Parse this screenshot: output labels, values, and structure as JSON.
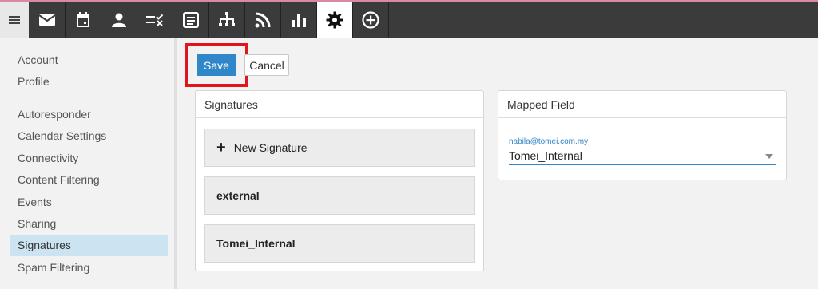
{
  "toolbar": {
    "apps": [
      {
        "name": "mail-icon"
      },
      {
        "name": "calendar-icon"
      },
      {
        "name": "contacts-icon"
      },
      {
        "name": "tasks-icon"
      },
      {
        "name": "notes-icon"
      },
      {
        "name": "org-chart-icon"
      },
      {
        "name": "rss-icon"
      },
      {
        "name": "reports-icon"
      },
      {
        "name": "settings-icon",
        "active": true
      },
      {
        "name": "add-circle-icon"
      }
    ]
  },
  "sidebar": {
    "items": [
      {
        "label": "Account"
      },
      {
        "label": "Profile"
      },
      {
        "label": "Autoresponder"
      },
      {
        "label": "Calendar Settings"
      },
      {
        "label": "Connectivity"
      },
      {
        "label": "Content Filtering"
      },
      {
        "label": "Events"
      },
      {
        "label": "Sharing"
      },
      {
        "label": "Signatures",
        "selected": true
      },
      {
        "label": "Spam Filtering"
      }
    ]
  },
  "actions": {
    "save_label": "Save",
    "cancel_label": "Cancel"
  },
  "signatures": {
    "title": "Signatures",
    "new_label": "New Signature",
    "items": [
      "external",
      "Tomei_Internal"
    ]
  },
  "mapped_field": {
    "title": "Mapped Field",
    "field_label": "nabila@tomei.com.my",
    "selected_value": "Tomei_Internal"
  },
  "colors": {
    "accent": "#2f86c8",
    "highlight_box": "#e0161b",
    "toolbar_bg": "#3b3b3b",
    "selected_nav": "#cce4f1"
  }
}
